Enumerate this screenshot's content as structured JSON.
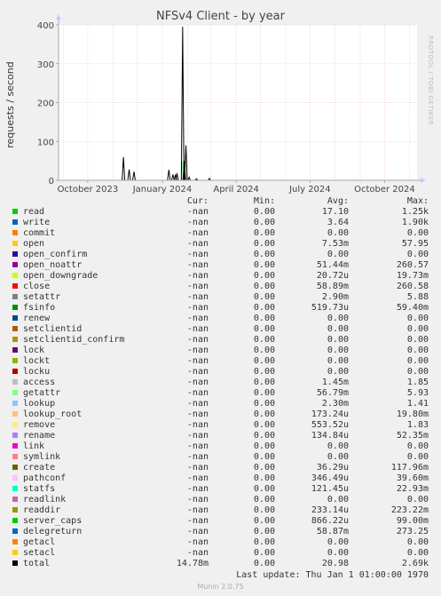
{
  "title": "NFSv4 Client - by year",
  "y_axis_label": "requests / second",
  "watermark": "RRDTOOL / TOBI OETIKER",
  "chart_data": {
    "type": "line",
    "title": "NFSv4 Client - by year",
    "ylabel": "requests / second",
    "ylim": [
      0,
      400
    ],
    "y_ticks": [
      0,
      100,
      200,
      300,
      400
    ],
    "x_ticks": [
      "October 2023",
      "January 2024",
      "April 2024",
      "July 2024",
      "October 2024"
    ],
    "grid": true,
    "series": [
      {
        "name": "total",
        "x": [
          "2023-11-14",
          "2023-11-21",
          "2023-11-27",
          "2024-01-09",
          "2024-01-14",
          "2024-01-17",
          "2024-01-19",
          "2024-01-26",
          "2024-01-28",
          "2024-01-30",
          "2024-02-03",
          "2024-02-12",
          "2024-02-28"
        ],
        "values": [
          60,
          28,
          22,
          27,
          15,
          13,
          18,
          395,
          50,
          90,
          8,
          4,
          5
        ]
      },
      {
        "name": "getattr",
        "x": [
          "2023-11-14",
          "2024-01-19",
          "2024-01-26",
          "2024-01-28"
        ],
        "values": [
          5,
          15,
          50,
          20
        ]
      }
    ]
  },
  "legend": {
    "headers": {
      "cur": "Cur:",
      "min": "Min:",
      "avg": "Avg:",
      "max": "Max:"
    },
    "rows": [
      {
        "name": "read",
        "color": "#00cc00",
        "cur": "-nan",
        "min": "0.00",
        "avg": "17.10",
        "max": "1.25k"
      },
      {
        "name": "write",
        "color": "#0066b3",
        "cur": "-nan",
        "min": "0.00",
        "avg": "3.64",
        "max": "1.90k"
      },
      {
        "name": "commit",
        "color": "#ff8000",
        "cur": "-nan",
        "min": "0.00",
        "avg": "0.00",
        "max": "0.00"
      },
      {
        "name": "open",
        "color": "#ffcc00",
        "cur": "-nan",
        "min": "0.00",
        "avg": "7.53m",
        "max": "57.95"
      },
      {
        "name": "open_confirm",
        "color": "#330099",
        "cur": "-nan",
        "min": "0.00",
        "avg": "0.00",
        "max": "0.00"
      },
      {
        "name": "open_noattr",
        "color": "#990099",
        "cur": "-nan",
        "min": "0.00",
        "avg": "51.44m",
        "max": "260.57"
      },
      {
        "name": "open_downgrade",
        "color": "#ccff00",
        "cur": "-nan",
        "min": "0.00",
        "avg": "20.72u",
        "max": "19.73m"
      },
      {
        "name": "close",
        "color": "#ff0000",
        "cur": "-nan",
        "min": "0.00",
        "avg": "58.89m",
        "max": "260.58"
      },
      {
        "name": "setattr",
        "color": "#808080",
        "cur": "-nan",
        "min": "0.00",
        "avg": "2.90m",
        "max": "5.88"
      },
      {
        "name": "fsinfo",
        "color": "#008f00",
        "cur": "-nan",
        "min": "0.00",
        "avg": "519.73u",
        "max": "59.40m"
      },
      {
        "name": "renew",
        "color": "#00487d",
        "cur": "-nan",
        "min": "0.00",
        "avg": "0.00",
        "max": "0.00"
      },
      {
        "name": "setclientid",
        "color": "#b35a00",
        "cur": "-nan",
        "min": "0.00",
        "avg": "0.00",
        "max": "0.00"
      },
      {
        "name": "setclientid_confirm",
        "color": "#b38f00",
        "cur": "-nan",
        "min": "0.00",
        "avg": "0.00",
        "max": "0.00"
      },
      {
        "name": "lock",
        "color": "#6b006b",
        "cur": "-nan",
        "min": "0.00",
        "avg": "0.00",
        "max": "0.00"
      },
      {
        "name": "lockt",
        "color": "#8fb300",
        "cur": "-nan",
        "min": "0.00",
        "avg": "0.00",
        "max": "0.00"
      },
      {
        "name": "locku",
        "color": "#b30000",
        "cur": "-nan",
        "min": "0.00",
        "avg": "0.00",
        "max": "0.00"
      },
      {
        "name": "access",
        "color": "#bebebe",
        "cur": "-nan",
        "min": "0.00",
        "avg": "1.45m",
        "max": "1.85"
      },
      {
        "name": "getattr",
        "color": "#80ff80",
        "cur": "-nan",
        "min": "0.00",
        "avg": "56.79m",
        "max": "5.93"
      },
      {
        "name": "lookup",
        "color": "#80c9ff",
        "cur": "-nan",
        "min": "0.00",
        "avg": "2.30m",
        "max": "1.41"
      },
      {
        "name": "lookup_root",
        "color": "#ffc080",
        "cur": "-nan",
        "min": "0.00",
        "avg": "173.24u",
        "max": "19.80m"
      },
      {
        "name": "remove",
        "color": "#ffe680",
        "cur": "-nan",
        "min": "0.00",
        "avg": "553.52u",
        "max": "1.83"
      },
      {
        "name": "rename",
        "color": "#aa80ff",
        "cur": "-nan",
        "min": "0.00",
        "avg": "134.84u",
        "max": "52.35m"
      },
      {
        "name": "link",
        "color": "#ee00cc",
        "cur": "-nan",
        "min": "0.00",
        "avg": "0.00",
        "max": "0.00"
      },
      {
        "name": "symlink",
        "color": "#ff8080",
        "cur": "-nan",
        "min": "0.00",
        "avg": "0.00",
        "max": "0.00"
      },
      {
        "name": "create",
        "color": "#666600",
        "cur": "-nan",
        "min": "0.00",
        "avg": "36.29u",
        "max": "117.96m"
      },
      {
        "name": "pathconf",
        "color": "#ffbfff",
        "cur": "-nan",
        "min": "0.00",
        "avg": "346.49u",
        "max": "39.60m"
      },
      {
        "name": "statfs",
        "color": "#00ffcc",
        "cur": "-nan",
        "min": "0.00",
        "avg": "121.45u",
        "max": "22.93m"
      },
      {
        "name": "readlink",
        "color": "#cc6699",
        "cur": "-nan",
        "min": "0.00",
        "avg": "0.00",
        "max": "0.00"
      },
      {
        "name": "readdir",
        "color": "#999900",
        "cur": "-nan",
        "min": "0.00",
        "avg": "233.14u",
        "max": "223.22m"
      },
      {
        "name": "server_caps",
        "color": "#00cc00",
        "cur": "-nan",
        "min": "0.00",
        "avg": "866.22u",
        "max": "99.00m"
      },
      {
        "name": "delegreturn",
        "color": "#0066b3",
        "cur": "-nan",
        "min": "0.00",
        "avg": "58.87m",
        "max": "273.25"
      },
      {
        "name": "getacl",
        "color": "#ff8000",
        "cur": "-nan",
        "min": "0.00",
        "avg": "0.00",
        "max": "0.00"
      },
      {
        "name": "setacl",
        "color": "#ffcc00",
        "cur": "-nan",
        "min": "0.00",
        "avg": "0.00",
        "max": "0.00"
      },
      {
        "name": "total",
        "color": "#000000",
        "cur": "14.78m",
        "min": "0.00",
        "avg": "20.98",
        "max": "2.69k"
      }
    ]
  },
  "last_update": "Last update: Thu Jan  1 01:00:00 1970",
  "footer": "Munin 2.0.75"
}
